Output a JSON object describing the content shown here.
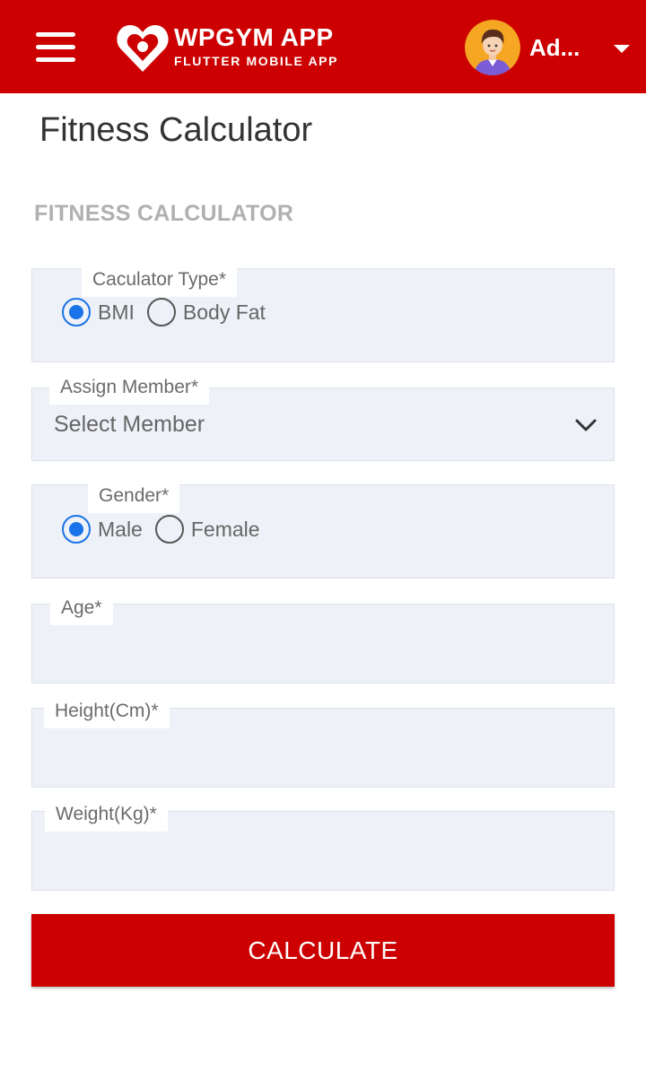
{
  "header": {
    "app_title": "WPGYM APP",
    "app_subtitle": "FLUTTER MOBILE APP",
    "user_name": "Ad...",
    "brand_color": "#cc0000"
  },
  "page": {
    "title": "Fitness Calculator",
    "section_title": "FITNESS CALCULATOR"
  },
  "form": {
    "calculator_type": {
      "label": "Caculator Type*",
      "options": [
        "BMI",
        "Body Fat"
      ],
      "selected": "BMI"
    },
    "assign_member": {
      "label": "Assign Member*",
      "value": "Select Member"
    },
    "gender": {
      "label": "Gender*",
      "options": [
        "Male",
        "Female"
      ],
      "selected": "Male"
    },
    "age": {
      "label": "Age*",
      "value": ""
    },
    "height": {
      "label": "Height(Cm)*",
      "value": ""
    },
    "weight": {
      "label": "Weight(Kg)*",
      "value": ""
    },
    "submit_label": "CALCULATE"
  },
  "icons": {
    "menu": "hamburger-menu-icon",
    "logo": "heart-logo-icon",
    "avatar": "user-avatar",
    "caret": "caret-down-icon",
    "chevron": "chevron-down-icon"
  },
  "colors": {
    "radio_active": "#1a73e8",
    "field_bg": "#eef1f7"
  }
}
